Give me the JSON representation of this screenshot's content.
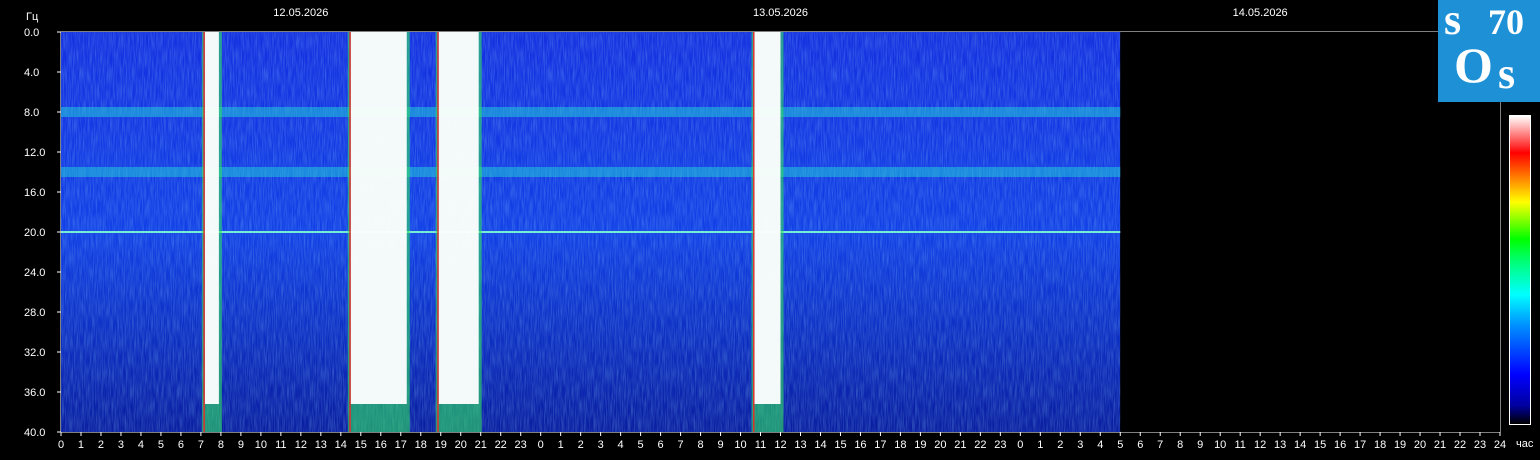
{
  "window": {
    "title": ""
  },
  "axes": {
    "y_unit": "Гц",
    "x_unit": "час",
    "y_ticks": [
      "0.0",
      "4.0",
      "8.0",
      "12.0",
      "16.0",
      "20.0",
      "24.0",
      "28.0",
      "32.0",
      "36.0",
      "40.0"
    ],
    "x_ticks": [
      "0",
      "1",
      "2",
      "3",
      "4",
      "5",
      "6",
      "7",
      "8",
      "9",
      "10",
      "11",
      "12",
      "13",
      "14",
      "15",
      "16",
      "17",
      "18",
      "19",
      "20",
      "21",
      "22",
      "23",
      "0",
      "1",
      "2",
      "3",
      "4",
      "5",
      "6",
      "7",
      "8",
      "9",
      "10",
      "11",
      "12",
      "13",
      "14",
      "15",
      "16",
      "17",
      "18",
      "19",
      "20",
      "21",
      "22",
      "23",
      "0",
      "1",
      "2",
      "3",
      "4",
      "5",
      "6",
      "7",
      "8",
      "9",
      "10",
      "11",
      "12",
      "13",
      "14",
      "15",
      "16",
      "17",
      "18",
      "19",
      "20",
      "21",
      "22",
      "23",
      "24"
    ]
  },
  "dates": [
    "12.05.2026",
    "13.05.2026",
    "14.05.2026"
  ],
  "logo": {
    "text": "SOS 70",
    "bg_color": "#1e90d6"
  },
  "colors": {
    "background": "#000000",
    "text": "#ffffff"
  },
  "chart_data": {
    "type": "heatmap",
    "title": "",
    "xlabel": "час",
    "ylabel": "Гц",
    "xlim": [
      0,
      72
    ],
    "ylim": [
      0,
      40
    ],
    "y_inverted": true,
    "data_end_hour": 53,
    "colorscale": [
      "#000000",
      "#0000ff",
      "#00ffff",
      "#00ff00",
      "#ffff00",
      "#ff0000",
      "#ffffff"
    ],
    "resonance_bands_hz": [
      8.0,
      14.0,
      20.0
    ],
    "high_intensity_intervals_hours": [
      [
        7.2,
        7.9
      ],
      [
        14.5,
        17.3
      ],
      [
        18.9,
        20.9
      ],
      [
        34.7,
        36.0
      ]
    ],
    "gridlines": false,
    "legend": "colorbar-right"
  }
}
